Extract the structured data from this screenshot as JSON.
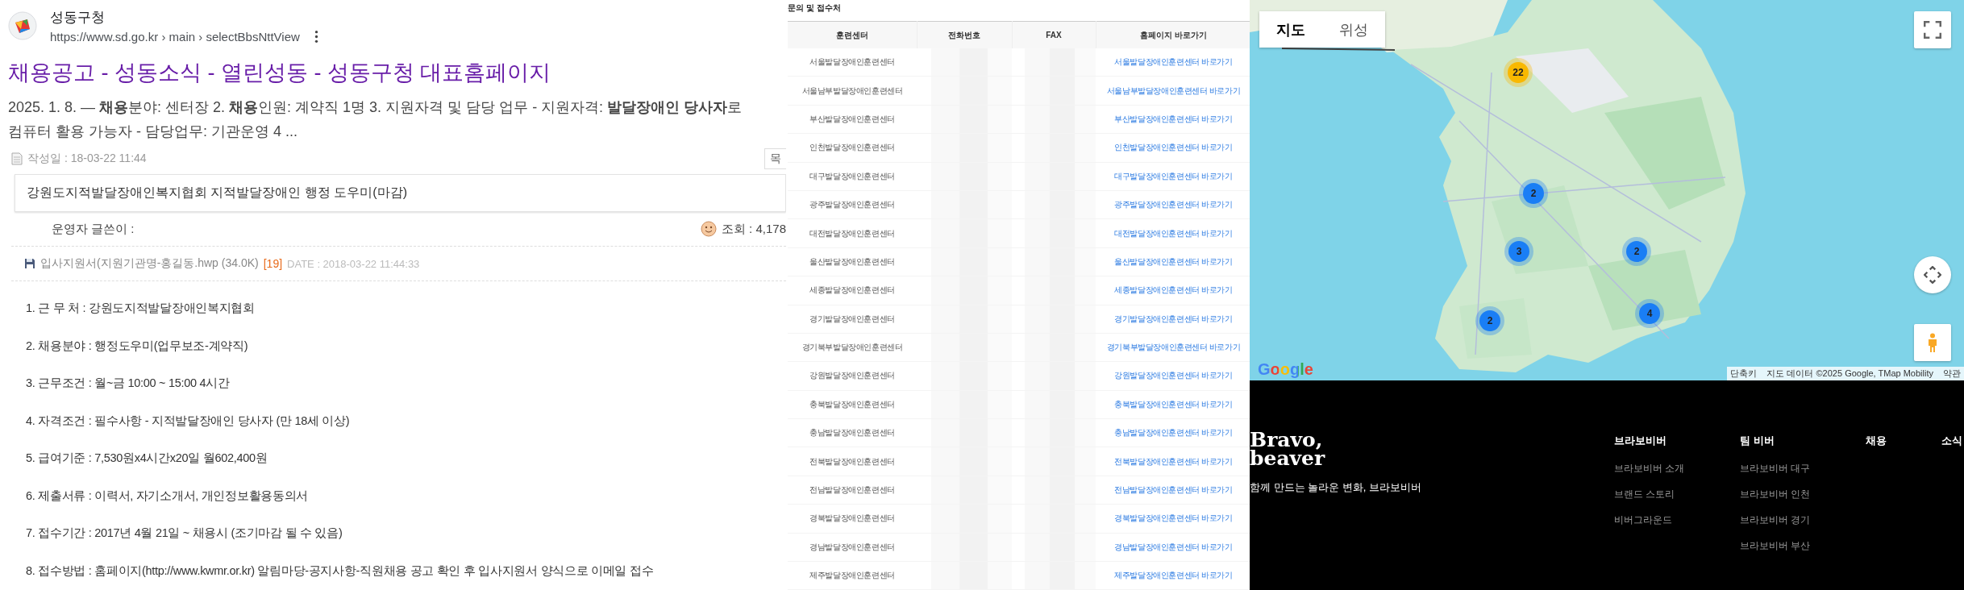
{
  "search_result": {
    "site_name": "성동구청",
    "url": "https://www.sd.go.kr › main › selectBbsNttView",
    "title": "채용공고 - 성동소식 - 열린성동 - 성동구청 대표홈페이지",
    "snippet": "2025. 1. 8. — **채용**분야: 센터장 2. **채용**인원: 계약직 1명 3. 지원자격 및 담당 업무 - 지원자격: **발달장애인 당사자**로 컴퓨터 활용 가능자 - 담당업무: 기관운영 4 ..."
  },
  "post": {
    "written": "작성일 : 18-03-22 11:44",
    "list_button": "목",
    "title": "강원도지적발달장애인복지협회 지적발달장애인 행정 도우미(마감)",
    "author": "운영자 글쓴이 :",
    "views": "조회 : 4,178",
    "attachment": {
      "name": "입사지원서(지원기관명-홍길동.hwp (34.0K)",
      "downloads": "[19]",
      "date": "DATE : 2018-03-22 11:44:33"
    },
    "items": [
      "1. 근 무 처 : 강원도지적발달장애인복지협회",
      "2. 채용분야 : 행정도우미(업무보조-계약직)",
      "3. 근무조건 : 월~금 10:00 ~ 15:00 4시간",
      "4. 자격조건 : 필수사항 - 지적발달장애인 당사자 (만 18세 이상)",
      "5. 급여기준 : 7,530원x4시간x20일 월602,400원",
      "6. 제출서류 : 이력서, 자기소개서, 개인정보활용동의서",
      "7. 접수기간 : 2017년 4월 21일 ~ 채용시 (조기마감 될 수 있음)",
      "8. 접수방법 : 홈페이지(http://www.kwmr.or.kr) 알림마당-공지사항-직원채용 공고 확인 후 입사지원서 양식으로 이메일 접수"
    ]
  },
  "contacts": {
    "title": "문의 및 접수처",
    "columns": [
      "훈련센터",
      "전화번호",
      "FAX",
      "홈페이지 바로가기"
    ],
    "rows": [
      {
        "center": "서울발달장애인훈련센터",
        "link": "서울발달장애인훈련센터 바로가기"
      },
      {
        "center": "서울남부발달장애인훈련센터",
        "link": "서울남부발달장애인훈련센터 바로가기"
      },
      {
        "center": "부산발달장애인훈련센터",
        "link": "부산발달장애인훈련센터 바로가기"
      },
      {
        "center": "인천발달장애인훈련센터",
        "link": "인천발달장애인훈련센터 바로가기"
      },
      {
        "center": "대구발달장애인훈련센터",
        "link": "대구발달장애인훈련센터 바로가기"
      },
      {
        "center": "광주발달장애인훈련센터",
        "link": "광주발달장애인훈련센터 바로가기"
      },
      {
        "center": "대전발달장애인훈련센터",
        "link": "대전발달장애인훈련센터 바로가기"
      },
      {
        "center": "울산발달장애인훈련센터",
        "link": "울산발달장애인훈련센터 바로가기"
      },
      {
        "center": "세종발달장애인훈련센터",
        "link": "세종발달장애인훈련센터 바로가기"
      },
      {
        "center": "경기발달장애인훈련센터",
        "link": "경기발달장애인훈련센터 바로가기"
      },
      {
        "center": "경기북부발달장애인훈련센터",
        "link": "경기북부발달장애인훈련센터 바로가기"
      },
      {
        "center": "강원발달장애인훈련센터",
        "link": "강원발달장애인훈련센터 바로가기"
      },
      {
        "center": "충북발달장애인훈련센터",
        "link": "충북발달장애인훈련센터 바로가기"
      },
      {
        "center": "충남발달장애인훈련센터",
        "link": "충남발달장애인훈련센터 바로가기"
      },
      {
        "center": "전북발달장애인훈련센터",
        "link": "전북발달장애인훈련센터 바로가기"
      },
      {
        "center": "전남발달장애인훈련센터",
        "link": "전남발달장애인훈련센터 바로가기"
      },
      {
        "center": "경북발달장애인훈련센터",
        "link": "경북발달장애인훈련센터 바로가기"
      },
      {
        "center": "경남발달장애인훈련센터",
        "link": "경남발달장애인훈련센터 바로가기"
      },
      {
        "center": "제주발달장애인훈련센터",
        "link": "제주발달장애인훈련센터 바로가기"
      }
    ]
  },
  "map": {
    "map_types": [
      {
        "label": "지도",
        "selected": true
      },
      {
        "label": "위성",
        "selected": false
      }
    ],
    "clusters": [
      {
        "count": "22",
        "color": "#f9b800"
      },
      {
        "count": "2",
        "color": "#1a7ef5"
      },
      {
        "count": "3",
        "color": "#1a7ef5"
      },
      {
        "count": "2",
        "color": "#1a7ef5"
      },
      {
        "count": "4",
        "color": "#1a7ef5"
      },
      {
        "count": "2",
        "color": "#1a7ef5"
      }
    ],
    "logo": "Google",
    "shortcuts": "단축키",
    "attribution": "지도 데이터 ©2025 Google, TMap Mobility",
    "terms": "약관"
  },
  "footer": {
    "logo": "Bravo,\nbeaver",
    "tagline": "함께 만드는 놀라운 변화, 브라보비버",
    "columns": [
      {
        "heading": "브라보비버",
        "links": [
          "브라보비버 소개",
          "브랜드 스토리",
          "비버그라운드"
        ]
      },
      {
        "heading": "팀 비버",
        "links": [
          "브라보비버 대구",
          "브라보비버 인천",
          "브라보비버 경기",
          "브라보비버 부산"
        ]
      },
      {
        "heading": "채용"
      },
      {
        "heading": "소식"
      }
    ]
  }
}
